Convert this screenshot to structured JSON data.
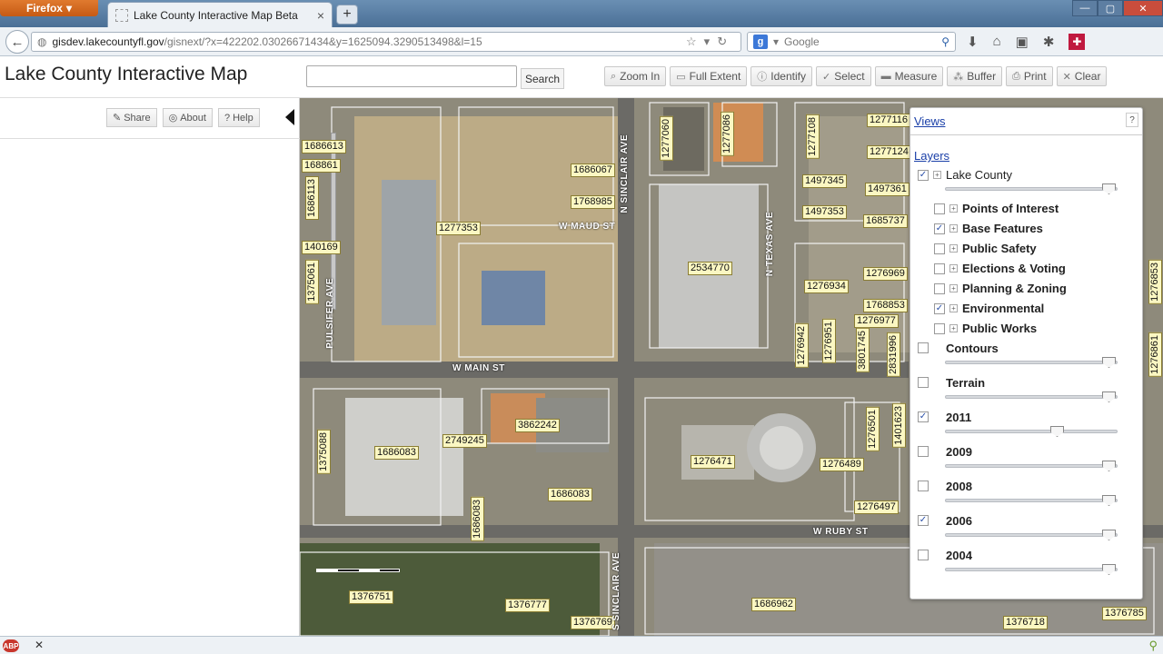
{
  "browser": {
    "firefox_label": "Firefox",
    "tab_title": "Lake County Interactive Map Beta",
    "tab_close": "×",
    "new_tab": "+",
    "url_host": "gisdev.lakecountyfl.gov",
    "url_path": "/gisnext/?x=422202.03026671434&y=1625094.3290513498&l=15",
    "search_engine_placeholder": "Google",
    "window_buttons": [
      "—",
      "▢",
      "✕"
    ]
  },
  "app": {
    "title": "Lake County Interactive Map",
    "search_value": "",
    "search_button": "Search",
    "toolbar": [
      {
        "icon": "zoom-in-icon",
        "glyph": "⌕",
        "label": "Zoom In"
      },
      {
        "icon": "full-extent-icon",
        "glyph": "▭",
        "label": "Full Extent"
      },
      {
        "icon": "identify-icon",
        "glyph": "ⓘ",
        "label": "Identify"
      },
      {
        "icon": "select-icon",
        "glyph": "✓",
        "label": "Select"
      },
      {
        "icon": "measure-icon",
        "glyph": "▬",
        "label": "Measure"
      },
      {
        "icon": "buffer-icon",
        "glyph": "⁂",
        "label": "Buffer"
      },
      {
        "icon": "print-icon",
        "glyph": "⎙",
        "label": "Print"
      },
      {
        "icon": "clear-icon",
        "glyph": "✕",
        "label": "Clear"
      }
    ]
  },
  "left_panel": {
    "share": "Share",
    "about": "About",
    "help": "Help"
  },
  "map": {
    "parcels": [
      {
        "id": "1686613",
        "v": false
      },
      {
        "id": "168861",
        "v": false
      },
      {
        "id": "1686113",
        "v": true
      },
      {
        "id": "140169",
        "v": false
      },
      {
        "id": "1375061",
        "v": true
      },
      {
        "id": "1277353",
        "v": false
      },
      {
        "id": "1686067",
        "v": false
      },
      {
        "id": "1768985",
        "v": false
      },
      {
        "id": "1277060",
        "v": true
      },
      {
        "id": "1277086",
        "v": true
      },
      {
        "id": "2534770",
        "v": false
      },
      {
        "id": "1277108",
        "v": true
      },
      {
        "id": "1277116",
        "v": false
      },
      {
        "id": "1277124",
        "v": false
      },
      {
        "id": "1497345",
        "v": false
      },
      {
        "id": "1497361",
        "v": false
      },
      {
        "id": "1497353",
        "v": false
      },
      {
        "id": "1685737",
        "v": false
      },
      {
        "id": "1276969",
        "v": false
      },
      {
        "id": "1276934",
        "v": false
      },
      {
        "id": "1768853",
        "v": false
      },
      {
        "id": "1276977",
        "v": false
      },
      {
        "id": "1276942",
        "v": true
      },
      {
        "id": "1276951",
        "v": true
      },
      {
        "id": "3801745",
        "v": true
      },
      {
        "id": "2831996",
        "v": true
      },
      {
        "id": "3862242",
        "v": false
      },
      {
        "id": "2749245",
        "v": false
      },
      {
        "id": "1686083",
        "v": false
      },
      {
        "id": "1375088",
        "v": true
      },
      {
        "id": "1686083",
        "v": false
      },
      {
        "id": "1686083",
        "v": true
      },
      {
        "id": "1276471",
        "v": false
      },
      {
        "id": "1276489",
        "v": false
      },
      {
        "id": "1276501",
        "v": true
      },
      {
        "id": "1401623",
        "v": true
      },
      {
        "id": "1276497",
        "v": false
      },
      {
        "id": "1376751",
        "v": false
      },
      {
        "id": "1376777",
        "v": false
      },
      {
        "id": "1376769",
        "v": false
      },
      {
        "id": "1686962",
        "v": false
      },
      {
        "id": "1376718",
        "v": false
      },
      {
        "id": "1376785",
        "v": false
      },
      {
        "id": "1276853",
        "v": true
      },
      {
        "id": "1276861",
        "v": true
      }
    ],
    "streets": [
      {
        "name": "W MAUD ST",
        "v": false
      },
      {
        "name": "N SINCLAIR AVE",
        "v": true
      },
      {
        "name": "N TEXAS AVE",
        "v": true
      },
      {
        "name": "PULSIFER AVE",
        "v": true
      },
      {
        "name": "W MAIN ST",
        "v": false
      },
      {
        "name": "W RUBY ST",
        "v": false
      },
      {
        "name": "S SINCLAIR AVE",
        "v": true
      }
    ]
  },
  "layers_panel": {
    "views": "Views",
    "help": "?",
    "layers": "Layers",
    "lake_county": {
      "label": "Lake County",
      "checked": true,
      "opacity": 1.0
    },
    "sublayers": [
      {
        "label": "Points of Interest",
        "checked": false
      },
      {
        "label": "Base Features",
        "checked": true
      },
      {
        "label": "Public Safety",
        "checked": false
      },
      {
        "label": "Elections & Voting",
        "checked": false
      },
      {
        "label": "Planning & Zoning",
        "checked": false
      },
      {
        "label": "Environmental",
        "checked": true
      },
      {
        "label": "Public Works",
        "checked": false
      }
    ],
    "imagery": [
      {
        "label": "Contours",
        "checked": false,
        "opacity": 1.0
      },
      {
        "label": "Terrain",
        "checked": false,
        "opacity": 1.0
      },
      {
        "label": "2011",
        "checked": true,
        "opacity": 0.67
      },
      {
        "label": "2009",
        "checked": false,
        "opacity": 1.0
      },
      {
        "label": "2008",
        "checked": false,
        "opacity": 1.0
      },
      {
        "label": "2006",
        "checked": true,
        "opacity": 1.0
      },
      {
        "label": "2004",
        "checked": false,
        "opacity": 1.0
      }
    ]
  },
  "statusbar": {
    "abp": "ABP",
    "close": "✕"
  }
}
